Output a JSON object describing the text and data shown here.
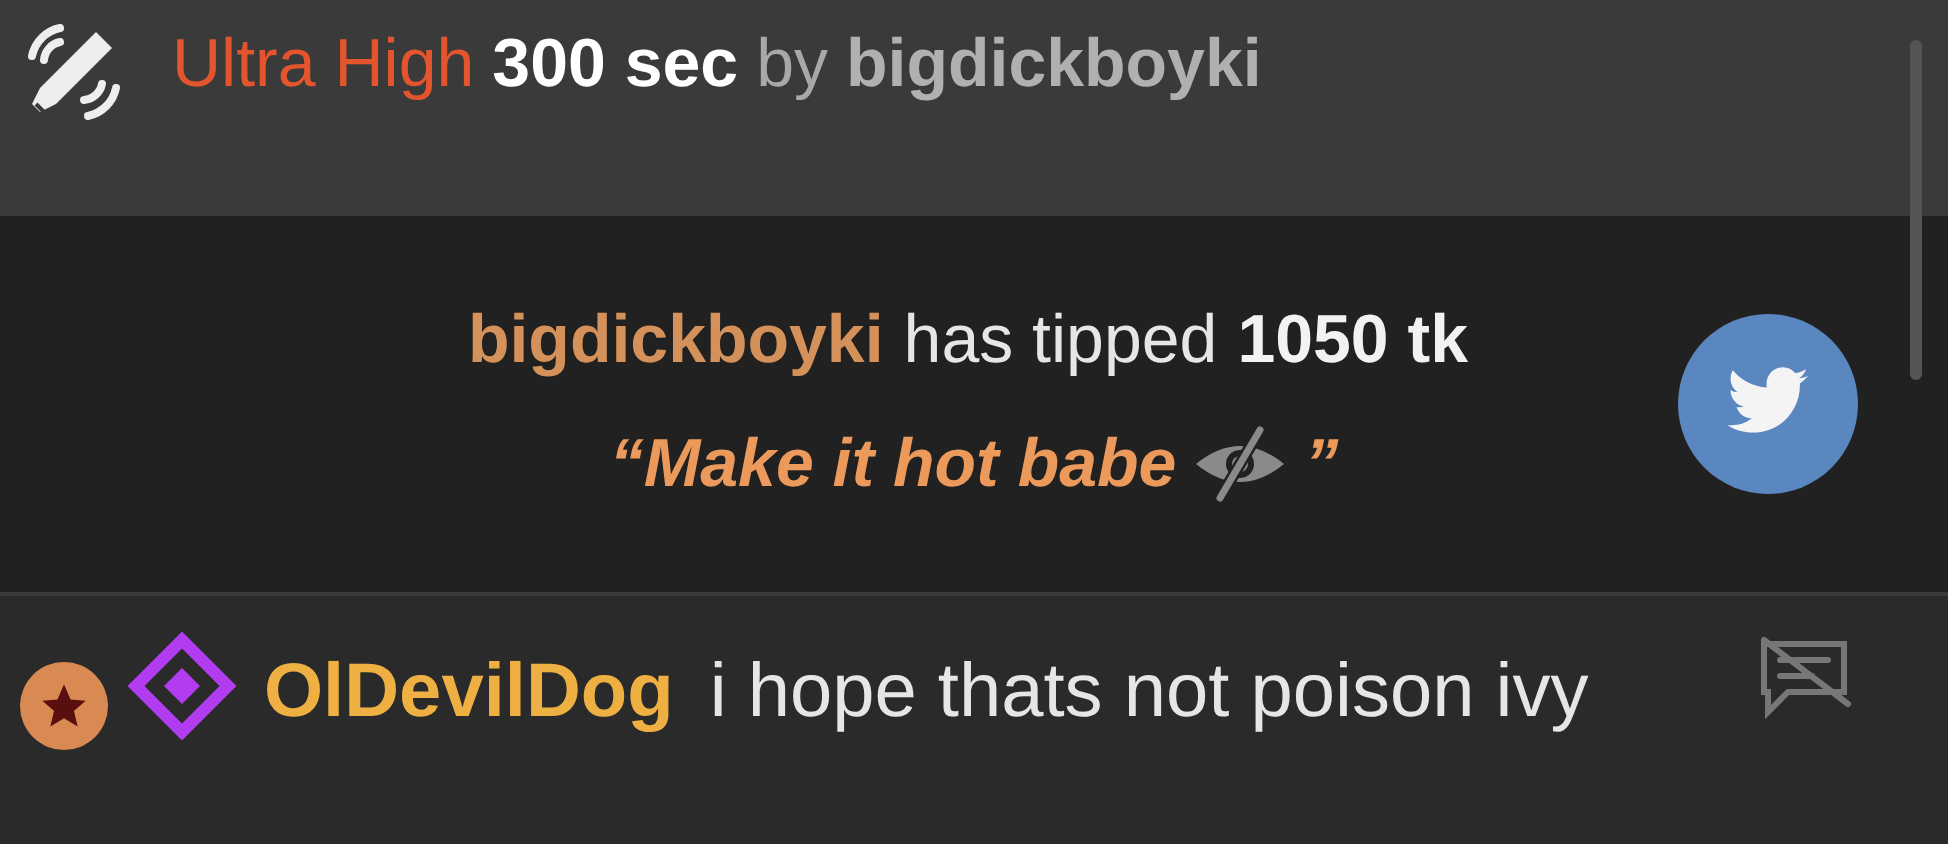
{
  "vibe_event": {
    "level_name": "Ultra High",
    "duration": "300 sec",
    "by": "by",
    "user": "bigdickboyki"
  },
  "tip": {
    "user": "bigdickboyki",
    "action": "has tipped",
    "amount": "1050 tk",
    "open_quote": "“",
    "message": "Make it hot babe",
    "close_quote": "”"
  },
  "chat": [
    {
      "user": "OlDevilDog",
      "text": "i hope thats not poison ivy"
    }
  ]
}
